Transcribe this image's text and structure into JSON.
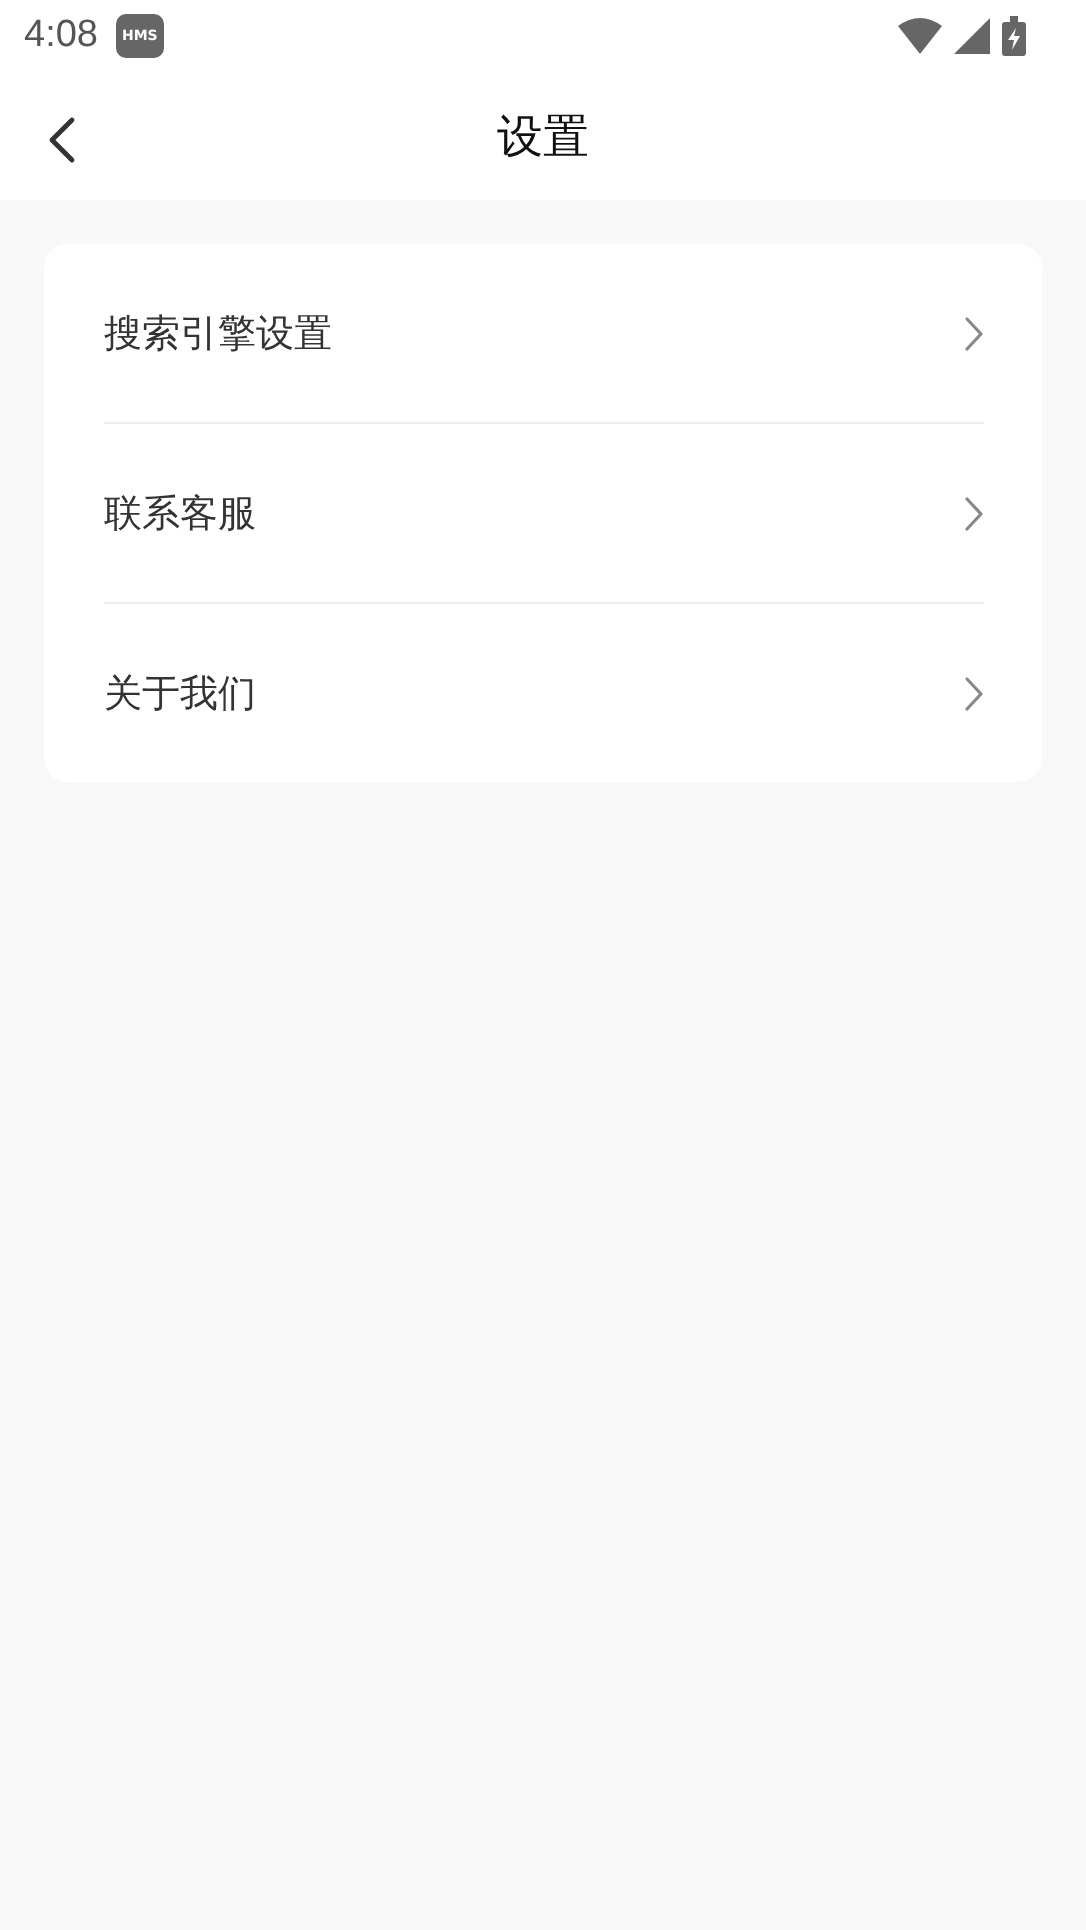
{
  "status_bar": {
    "time": "4:08",
    "badge": "HMS"
  },
  "header": {
    "title": "设置"
  },
  "menu": [
    {
      "label": "搜索引擎设置"
    },
    {
      "label": "联系客服"
    },
    {
      "label": "关于我们"
    }
  ]
}
